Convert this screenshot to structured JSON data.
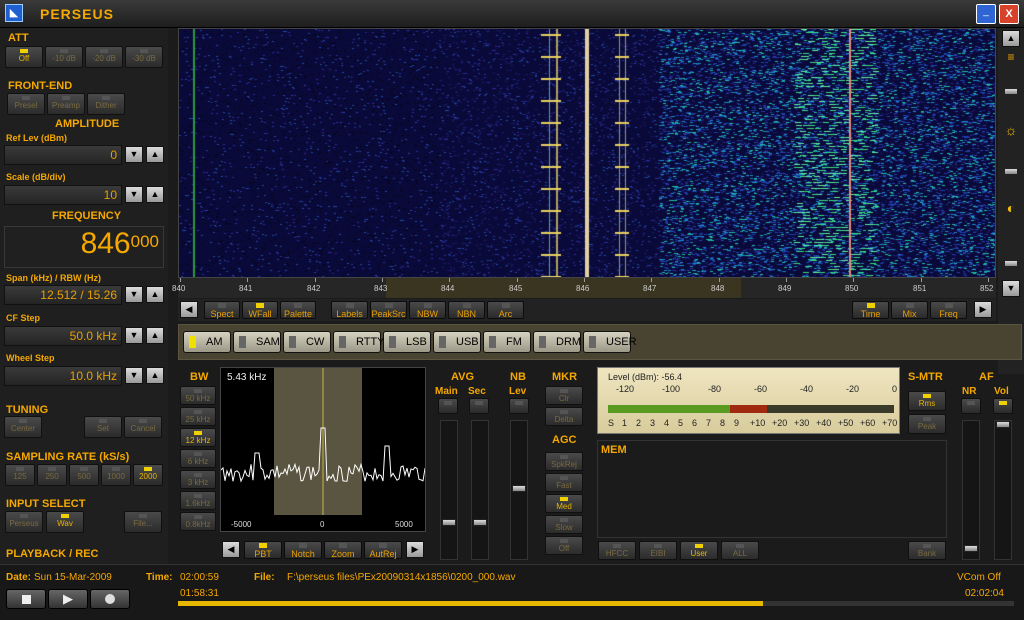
{
  "app": {
    "title": "PERSEUS"
  },
  "window_buttons": {
    "minimize": "_",
    "close": "X"
  },
  "att": {
    "label": "ATT",
    "buttons": [
      "Off",
      "-10 dB",
      "-20 dB",
      "-30 dB"
    ],
    "active": 0
  },
  "frontend": {
    "label": "FRONT-END",
    "buttons": [
      "Presel",
      "Preamp",
      "Dither"
    ]
  },
  "amplitude": {
    "label": "AMPLITUDE",
    "ref_label": "Ref Lev (dBm)",
    "ref_value": "0",
    "scale_label": "Scale (dB/div)",
    "scale_value": "10"
  },
  "frequency": {
    "label": "FREQUENCY",
    "main": "846",
    "sub": "000",
    "span_label": "Span (kHz) / RBW (Hz)",
    "span_value": "12.512 / 15.26",
    "cfstep_label": "CF Step",
    "cfstep_value": "50.0 kHz",
    "wheel_label": "Wheel Step",
    "wheel_value": "10.0 kHz"
  },
  "tuning": {
    "label": "TUNING",
    "buttons": [
      "Center",
      "Set",
      "Cancel"
    ]
  },
  "sampling": {
    "label": "SAMPLING RATE (kS/s)",
    "buttons": [
      "125",
      "250",
      "500",
      "1000",
      "2000"
    ],
    "active": 4
  },
  "input_select": {
    "label": "INPUT SELECT",
    "buttons": [
      "Perseus",
      "Wav",
      "File..."
    ],
    "active": 1
  },
  "playback": {
    "label": "PLAYBACK / REC"
  },
  "waterfall": {
    "axis_ticks": [
      "840",
      "841",
      "842",
      "843",
      "844",
      "845",
      "846",
      "847",
      "848",
      "849",
      "850",
      "851",
      "852"
    ]
  },
  "spectrum_toolbar": {
    "left": [
      "Spect",
      "WFall",
      "Palette"
    ],
    "mid": [
      "Labels",
      "PeakSrc",
      "NBW",
      "NBN",
      "Arc"
    ],
    "right": [
      "Time",
      "Mix",
      "Freq"
    ],
    "active": [
      "WFall",
      "Time"
    ]
  },
  "modes": {
    "items": [
      "AM",
      "SAM",
      "CW",
      "RTTY",
      "LSB",
      "USB",
      "FM",
      "DRM",
      "USER"
    ],
    "active": "AM"
  },
  "bw": {
    "label": "BW",
    "buttons": [
      "50 kHz",
      "25 kHz",
      "12 kHz",
      "6 kHz",
      "3 kHz",
      "1.6kHz",
      "0.8kHz"
    ],
    "active": 2,
    "display": "5.43 kHz",
    "axis": [
      "-5000",
      "0",
      "5000"
    ]
  },
  "filter_toolbar": {
    "buttons": [
      "PBT",
      "Notch",
      "Zoom",
      "AutRej"
    ],
    "active": "PBT"
  },
  "avg": {
    "label": "AVG",
    "main": "Main",
    "sec": "Sec"
  },
  "nb": {
    "label": "NB",
    "lev": "Lev"
  },
  "mkr": {
    "label": "MKR",
    "buttons": [
      "Clr",
      "Delta"
    ]
  },
  "agc": {
    "label": "AGC",
    "buttons": [
      "SpkRej",
      "Fast",
      "Med",
      "Slow",
      "Off"
    ],
    "active": "Med"
  },
  "smeter": {
    "level_label": "Level (dBm): -56.4",
    "top_scale": [
      "-120",
      "-100",
      "-80",
      "-60",
      "-40",
      "-20",
      "0"
    ],
    "bottom_scale": [
      "S",
      "1",
      "2",
      "3",
      "4",
      "5",
      "6",
      "7",
      "8",
      "9",
      "+10",
      "+20",
      "+30",
      "+40",
      "+50",
      "+60",
      "+70"
    ],
    "level_dbm": -56.4
  },
  "smtr": {
    "label": "S-MTR",
    "buttons": [
      "Rms",
      "Peak"
    ],
    "active": "Rms"
  },
  "af": {
    "label": "AF",
    "nr": "NR",
    "vol": "Vol"
  },
  "mem": {
    "label": "MEM",
    "buttons": [
      "HFCC",
      "EIBI",
      "User",
      "ALL",
      "Bank"
    ],
    "active": "User"
  },
  "status": {
    "date_label": "Date:",
    "date": "Sun 15-Mar-2009",
    "time_label": "Time:",
    "time": "02:00:59",
    "file_label": "File:",
    "file": "F:\\perseus files\\PEx20090314x1856\\0200_000.wav",
    "vcom": "VCom Off",
    "elapsed": "01:58:31",
    "total": "02:02:04",
    "progress": 0.7
  },
  "colors": {
    "accent": "#f5a800",
    "waterfall_bg": "#0a0a3a",
    "smeter_bg": "#e8dcb0"
  }
}
